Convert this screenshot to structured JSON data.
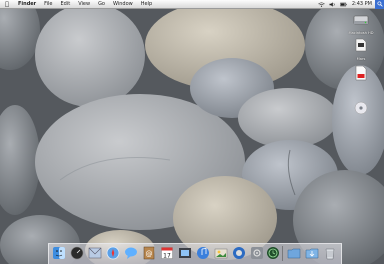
{
  "menubar": {
    "app_name": "Finder",
    "menus": [
      "File",
      "Edit",
      "View",
      "Go",
      "Window",
      "Help"
    ],
    "clock": "2:43 PM"
  },
  "desktop_icons": [
    {
      "label": "Macintosh HD",
      "icon": "hard-drive-icon"
    },
    {
      "label": "Mars",
      "icon": "document-icon"
    },
    {
      "label": "",
      "icon": "pdf-document-icon"
    },
    {
      "label": "",
      "icon": "disc-icon"
    }
  ],
  "dock_items": [
    "finder-icon",
    "dashboard-icon",
    "mail-icon",
    "safari-icon",
    "ichat-icon",
    "address-book-icon",
    "ical-icon",
    "preview-icon",
    "itunes-icon",
    "iphoto-icon",
    "imovie-icon",
    "system-preferences-icon",
    "time-machine-icon",
    "network-folder-icon",
    "downloads-icon",
    "trash-icon"
  ]
}
